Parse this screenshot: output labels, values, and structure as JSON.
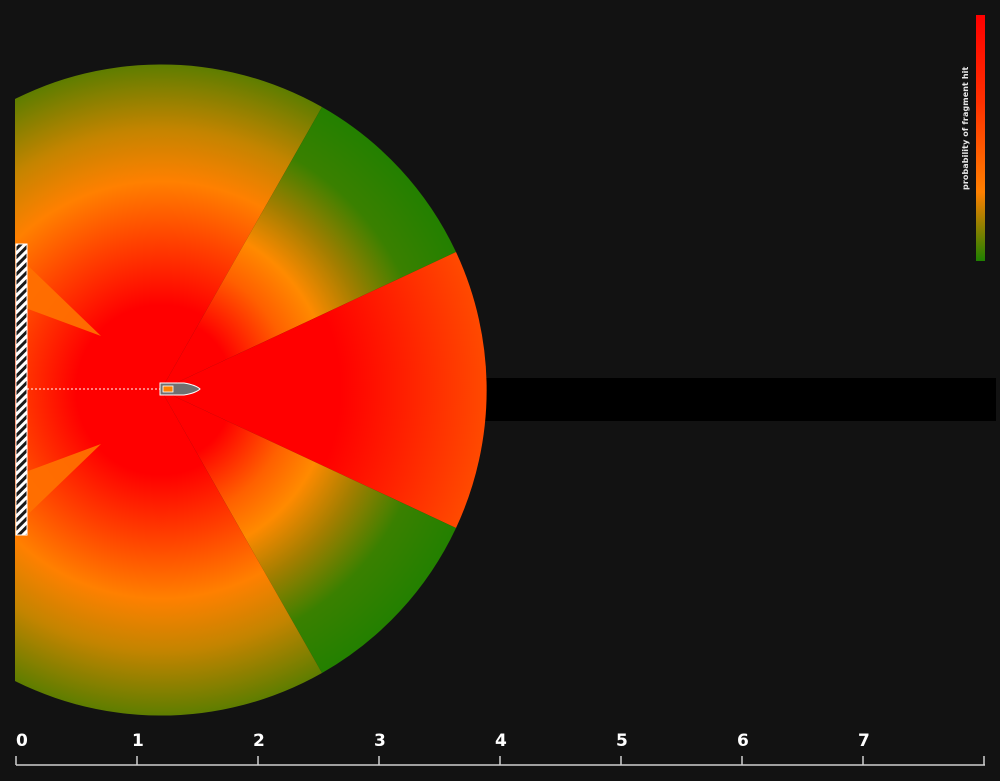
{
  "legend": {
    "title": "probability of fragment hit",
    "colors": {
      "high": "#ff0000",
      "mid": "#ff8000",
      "low": "#1f8000"
    }
  },
  "background_color": "#121212",
  "scale": {
    "min": 0,
    "max": 8,
    "labels": [
      "0",
      "1",
      "2",
      "3",
      "4",
      "5",
      "6",
      "7"
    ]
  },
  "icons": {
    "projectile": "bullet-icon",
    "target_plate": "hatched-plate-icon",
    "trajectory": "dotted-line"
  },
  "sectors": [
    {
      "name": "top-outer-sector",
      "level": "low"
    },
    {
      "name": "top-side-sector",
      "level": "lowest"
    },
    {
      "name": "forward-spray-sector",
      "level": "high"
    },
    {
      "name": "bottom-side-sector",
      "level": "lowest"
    },
    {
      "name": "bottom-outer-sector",
      "level": "low"
    }
  ]
}
